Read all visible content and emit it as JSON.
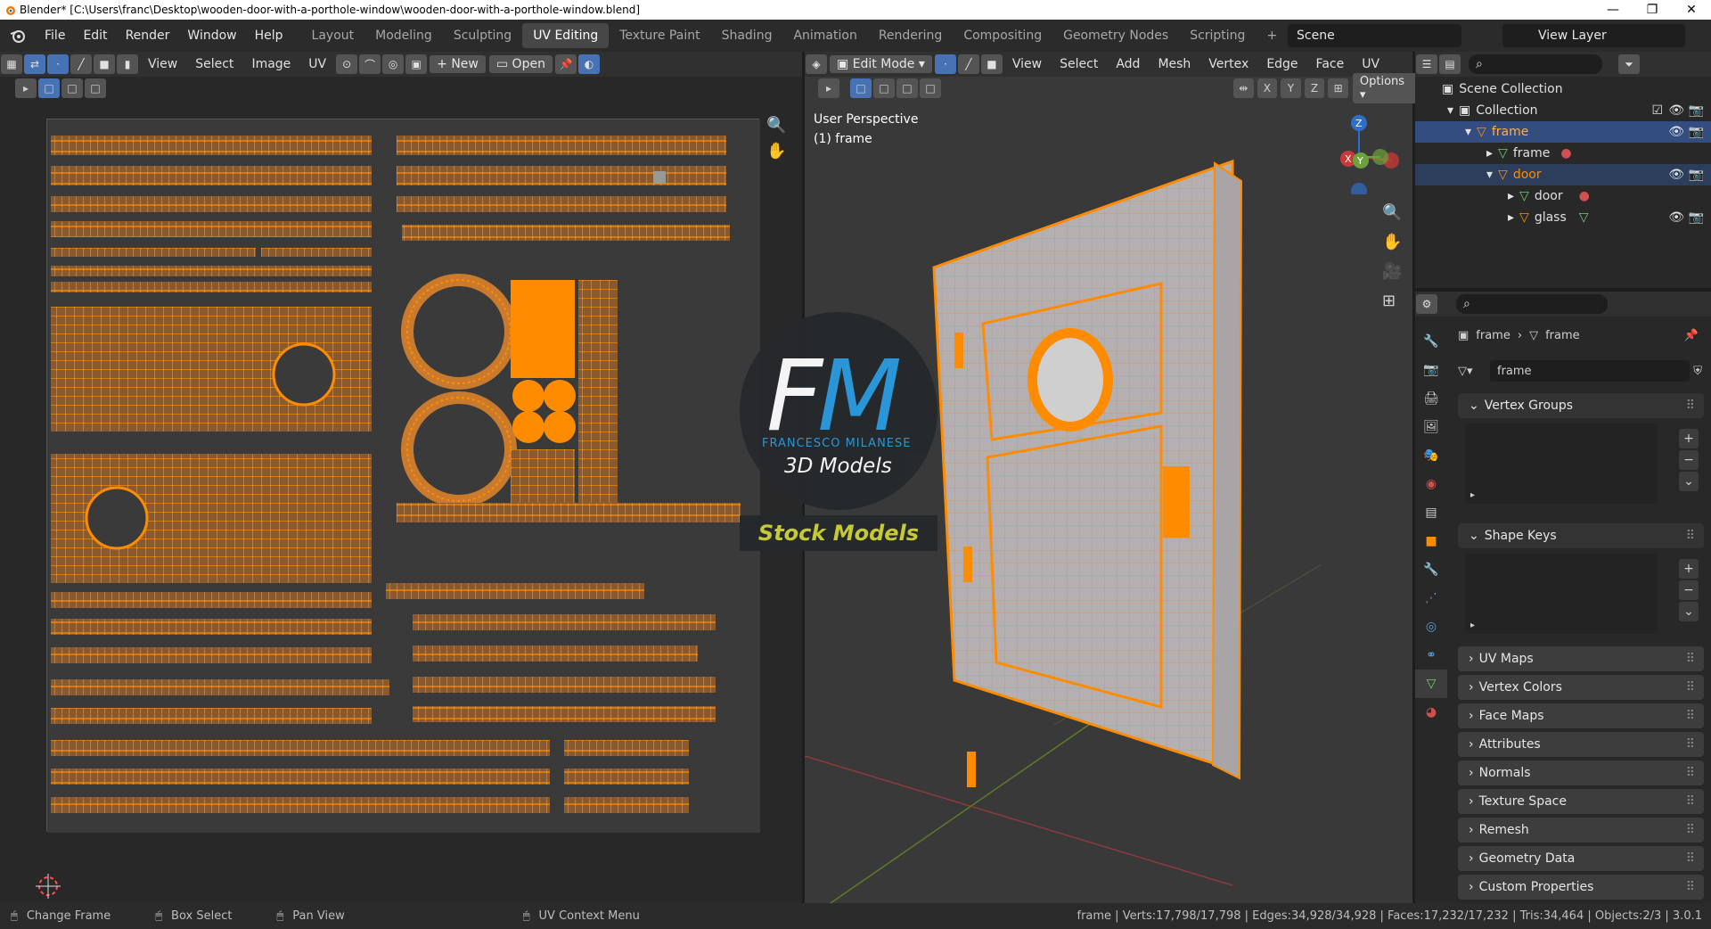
{
  "title": {
    "text": "Blender* [C:\\Users\\franc\\Desktop\\wooden-door-with-a-porthole-window\\wooden-door-with-a-porthole-window.blend]"
  },
  "menu": [
    "File",
    "Edit",
    "Render",
    "Window",
    "Help"
  ],
  "workspaces": [
    "Layout",
    "Modeling",
    "Sculpting",
    "UV Editing",
    "Texture Paint",
    "Shading",
    "Animation",
    "Rendering",
    "Compositing",
    "Geometry Nodes",
    "Scripting"
  ],
  "active_workspace": "UV Editing",
  "scene": "Scene",
  "view_layer": "View Layer",
  "uv_header": {
    "view": "View",
    "select": "Select",
    "image": "Image",
    "uv": "UV",
    "new": "New",
    "open": "Open"
  },
  "vp_header": {
    "mode": "Edit Mode",
    "view": "View",
    "select": "Select",
    "add": "Add",
    "mesh": "Mesh",
    "vertex": "Vertex",
    "edge": "Edge",
    "face": "Face",
    "uv": "UV",
    "options": "Options",
    "x": "X",
    "y": "Y",
    "z": "Z"
  },
  "viewport": {
    "perspective": "User Perspective",
    "object": "(1) frame"
  },
  "watermark": {
    "fm": "FM",
    "name": "FRANCESCO MILANESE",
    "models": "3D Models",
    "stock": "Stock Models"
  },
  "outliner": {
    "scene_collection": "Scene Collection",
    "collection": "Collection",
    "items": [
      {
        "label": "frame",
        "level": 1
      },
      {
        "label": "frame",
        "level": 2
      },
      {
        "label": "door",
        "level": 2
      },
      {
        "label": "door",
        "level": 3
      },
      {
        "label": "glass",
        "level": 3
      }
    ]
  },
  "properties": {
    "breadcrumb_object": "frame",
    "breadcrumb_data": "frame",
    "data_name": "frame",
    "panels_open": [
      "Vertex Groups",
      "Shape Keys"
    ],
    "panels_closed": [
      "UV Maps",
      "Vertex Colors",
      "Face Maps",
      "Attributes",
      "Normals",
      "Texture Space",
      "Remesh",
      "Geometry Data",
      "Custom Properties"
    ]
  },
  "status": {
    "change_frame": "Change Frame",
    "box_select": "Box Select",
    "pan_view": "Pan View",
    "uv_context": "UV Context Menu",
    "stats": "frame | Verts:17,798/17,798 | Edges:34,928/34,928 | Faces:17,232/17,232 | Tris:34,464 | Objects:2/3 | 3.0.1"
  },
  "colors": {
    "accent": "#ff8c00",
    "select": "#4772b3",
    "bg": "#1d1d1d"
  }
}
